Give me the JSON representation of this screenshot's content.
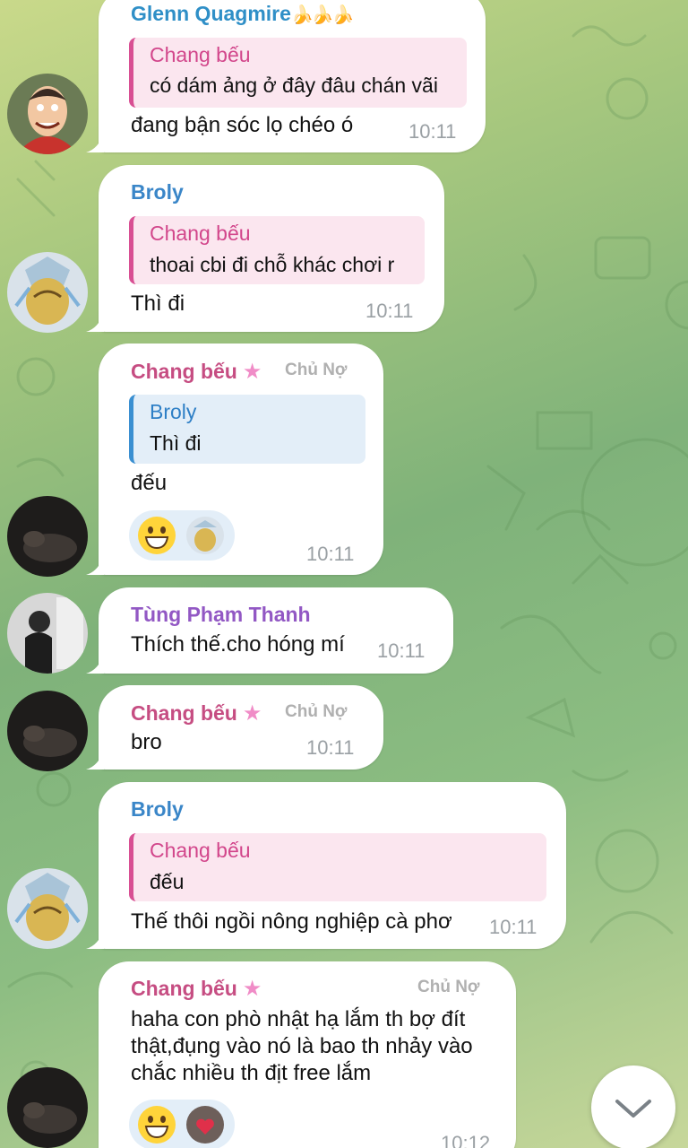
{
  "colors": {
    "name_glenn": "#2f8fc7",
    "name_broly": "#3a86c8",
    "name_chang": "#c64d82",
    "name_tung": "#9258c4",
    "quote_pink_bar": "#d84f93",
    "quote_blue_bar": "#3a8fd1"
  },
  "messages": [
    {
      "sender": "Glenn Quagmire",
      "sender_suffix": "🍌🍌🍌",
      "reply_to": {
        "name": "Chang bếu",
        "text": "có dám ảng ở đây đâu chán vãi"
      },
      "text": "đang bận sóc lọ chéo ó",
      "time": "10:11",
      "avatar": "glenn-avatar"
    },
    {
      "sender": "Broly",
      "reply_to": {
        "name": "Chang bếu",
        "text": "thoai cbi đi chỗ khác chơi r"
      },
      "text": "Thì đi",
      "time": "10:11",
      "avatar": "broly-avatar"
    },
    {
      "sender": "Chang bếu",
      "tag": "Chủ Nợ",
      "reply_to": {
        "name": "Broly",
        "text": "Thì đi"
      },
      "text": "đếu",
      "time": "10:11",
      "reactions": [
        "grinning-emoji",
        "broly-reactor-avatar"
      ],
      "avatar": "chang-avatar"
    },
    {
      "sender": "Tùng Phạm Thanh",
      "text": "Thích thế.cho hóng mí",
      "time": "10:11",
      "avatar": "tung-avatar"
    },
    {
      "sender": "Chang bếu",
      "tag": "Chủ Nợ",
      "text": "bro",
      "time": "10:11",
      "avatar": "chang-avatar"
    },
    {
      "sender": "Broly",
      "reply_to": {
        "name": "Chang bếu",
        "text": "đếu"
      },
      "text": "Thế thôi ngồi nông nghiệp cà phơ",
      "time": "10:11",
      "avatar": "broly-avatar"
    },
    {
      "sender": "Chang bếu",
      "tag": "Chủ Nợ",
      "text_lines": [
        "haha con phò nhật hạ lắm th bợ đít",
        "thật,đụng vào nó là bao th nhảy vào",
        "chắc nhiều th địt free lắm"
      ],
      "time": "10:12",
      "reactions": [
        "grinning-emoji",
        "heart-reactor-avatar"
      ],
      "avatar": "chang-avatar"
    }
  ],
  "scroll_button": {
    "icon": "chevron-down-icon"
  }
}
